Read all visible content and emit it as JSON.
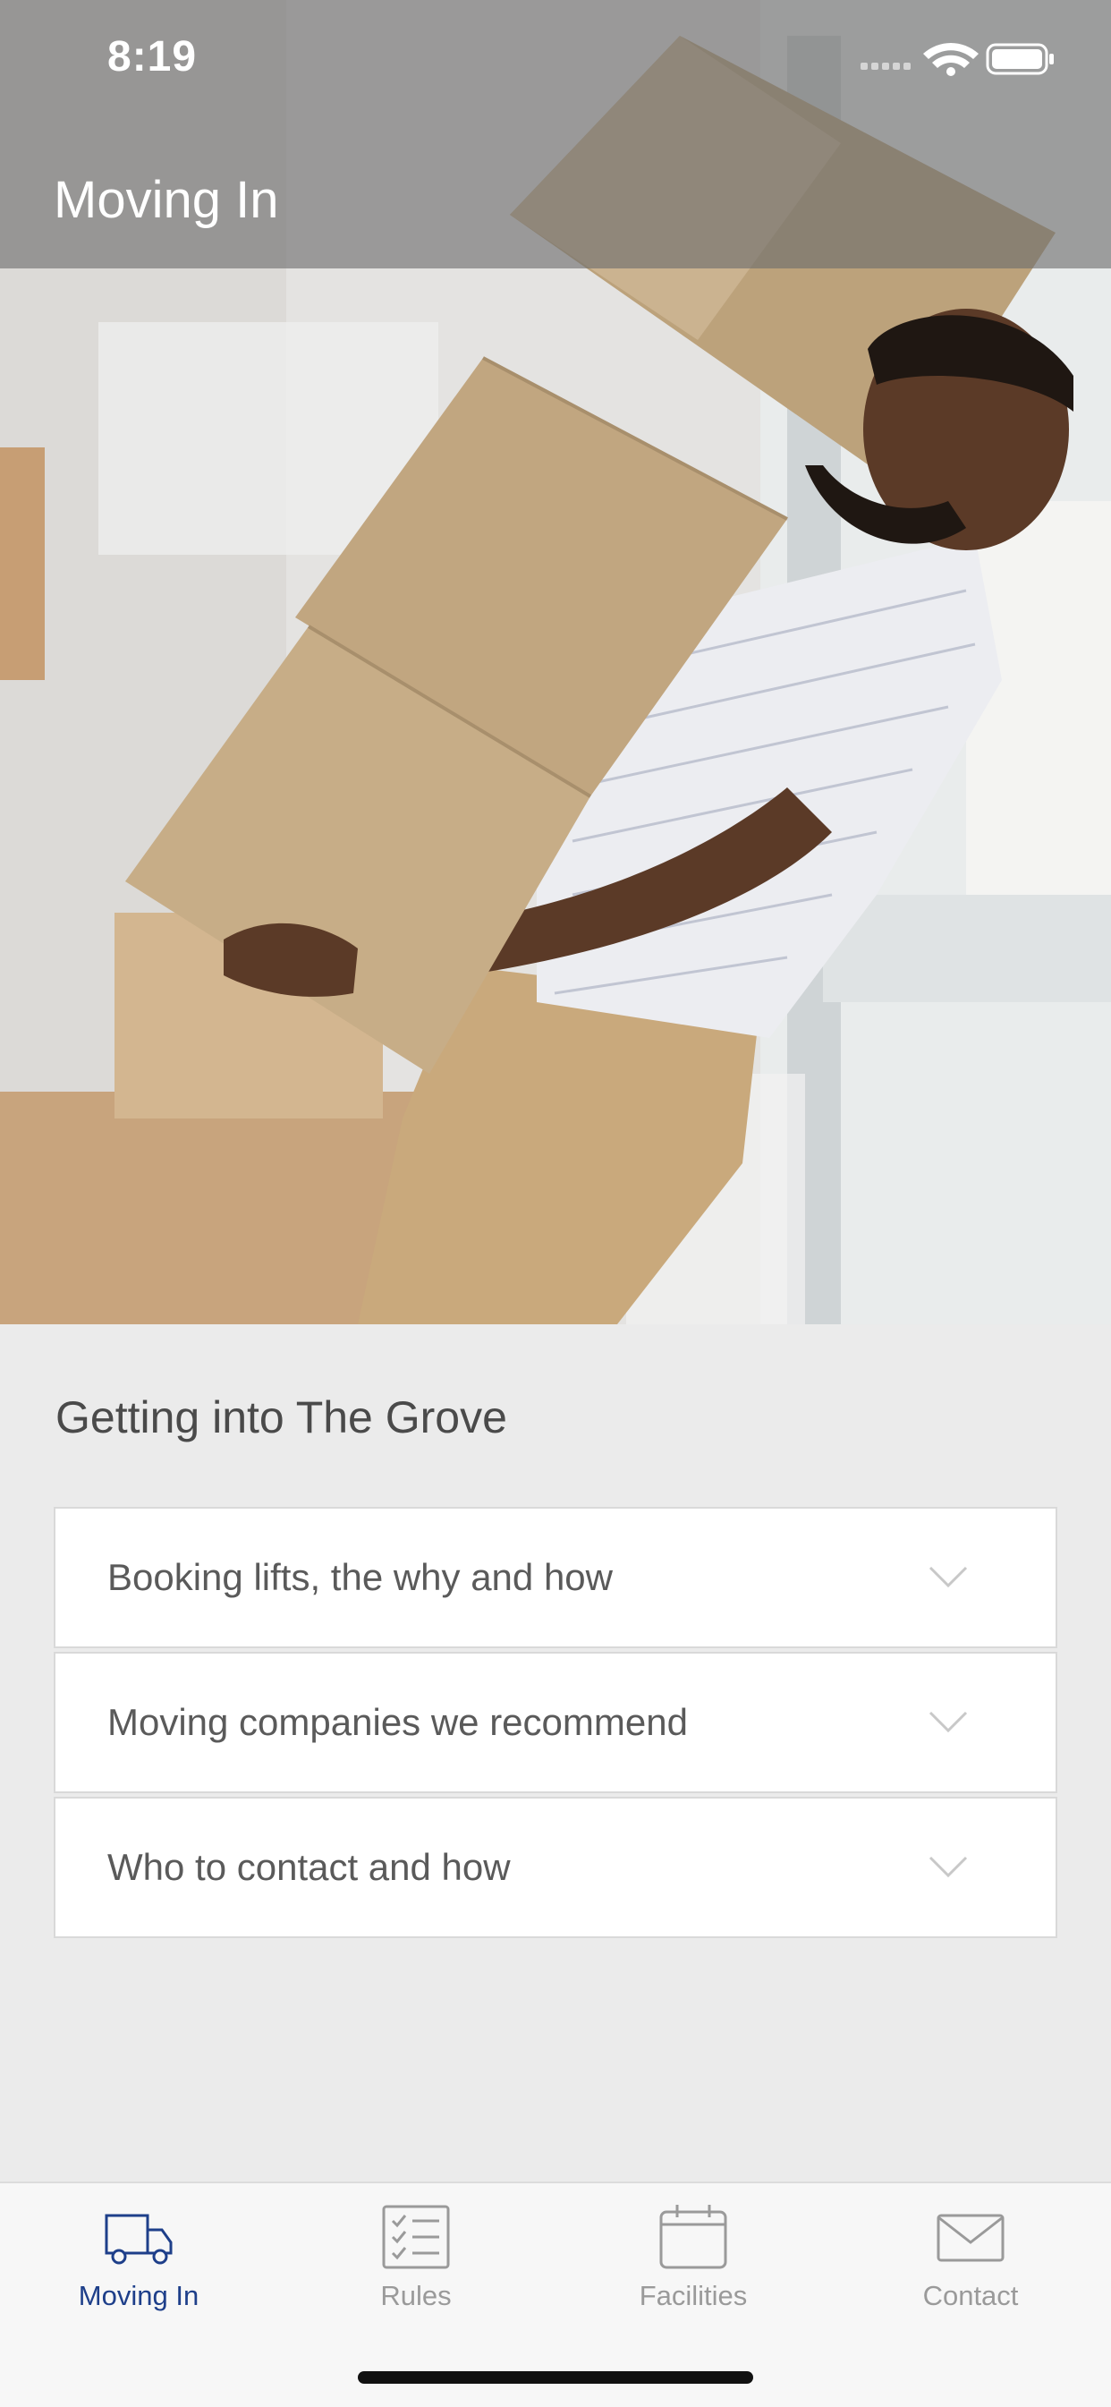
{
  "status_bar": {
    "time": "8:19"
  },
  "header": {
    "title": "Moving In"
  },
  "hero": {
    "image": "person-carrying-moving-boxes-photo"
  },
  "main": {
    "section_title": "Getting into The Grove",
    "accordion": [
      {
        "label": "Booking lifts, the why and how"
      },
      {
        "label": "Moving companies we recommend"
      },
      {
        "label": "Who to contact and how"
      }
    ]
  },
  "tabbar": {
    "active": "Moving In",
    "tabs": [
      {
        "label": "Moving In",
        "icon": "truck-icon"
      },
      {
        "label": "Rules",
        "icon": "checklist-icon"
      },
      {
        "label": "Facilities",
        "icon": "calendar-icon"
      },
      {
        "label": "Contact",
        "icon": "envelope-icon"
      }
    ]
  },
  "colors": {
    "accent": "#1e3f8a",
    "inactive": "#9a9a9a",
    "background": "#ebebeb"
  }
}
